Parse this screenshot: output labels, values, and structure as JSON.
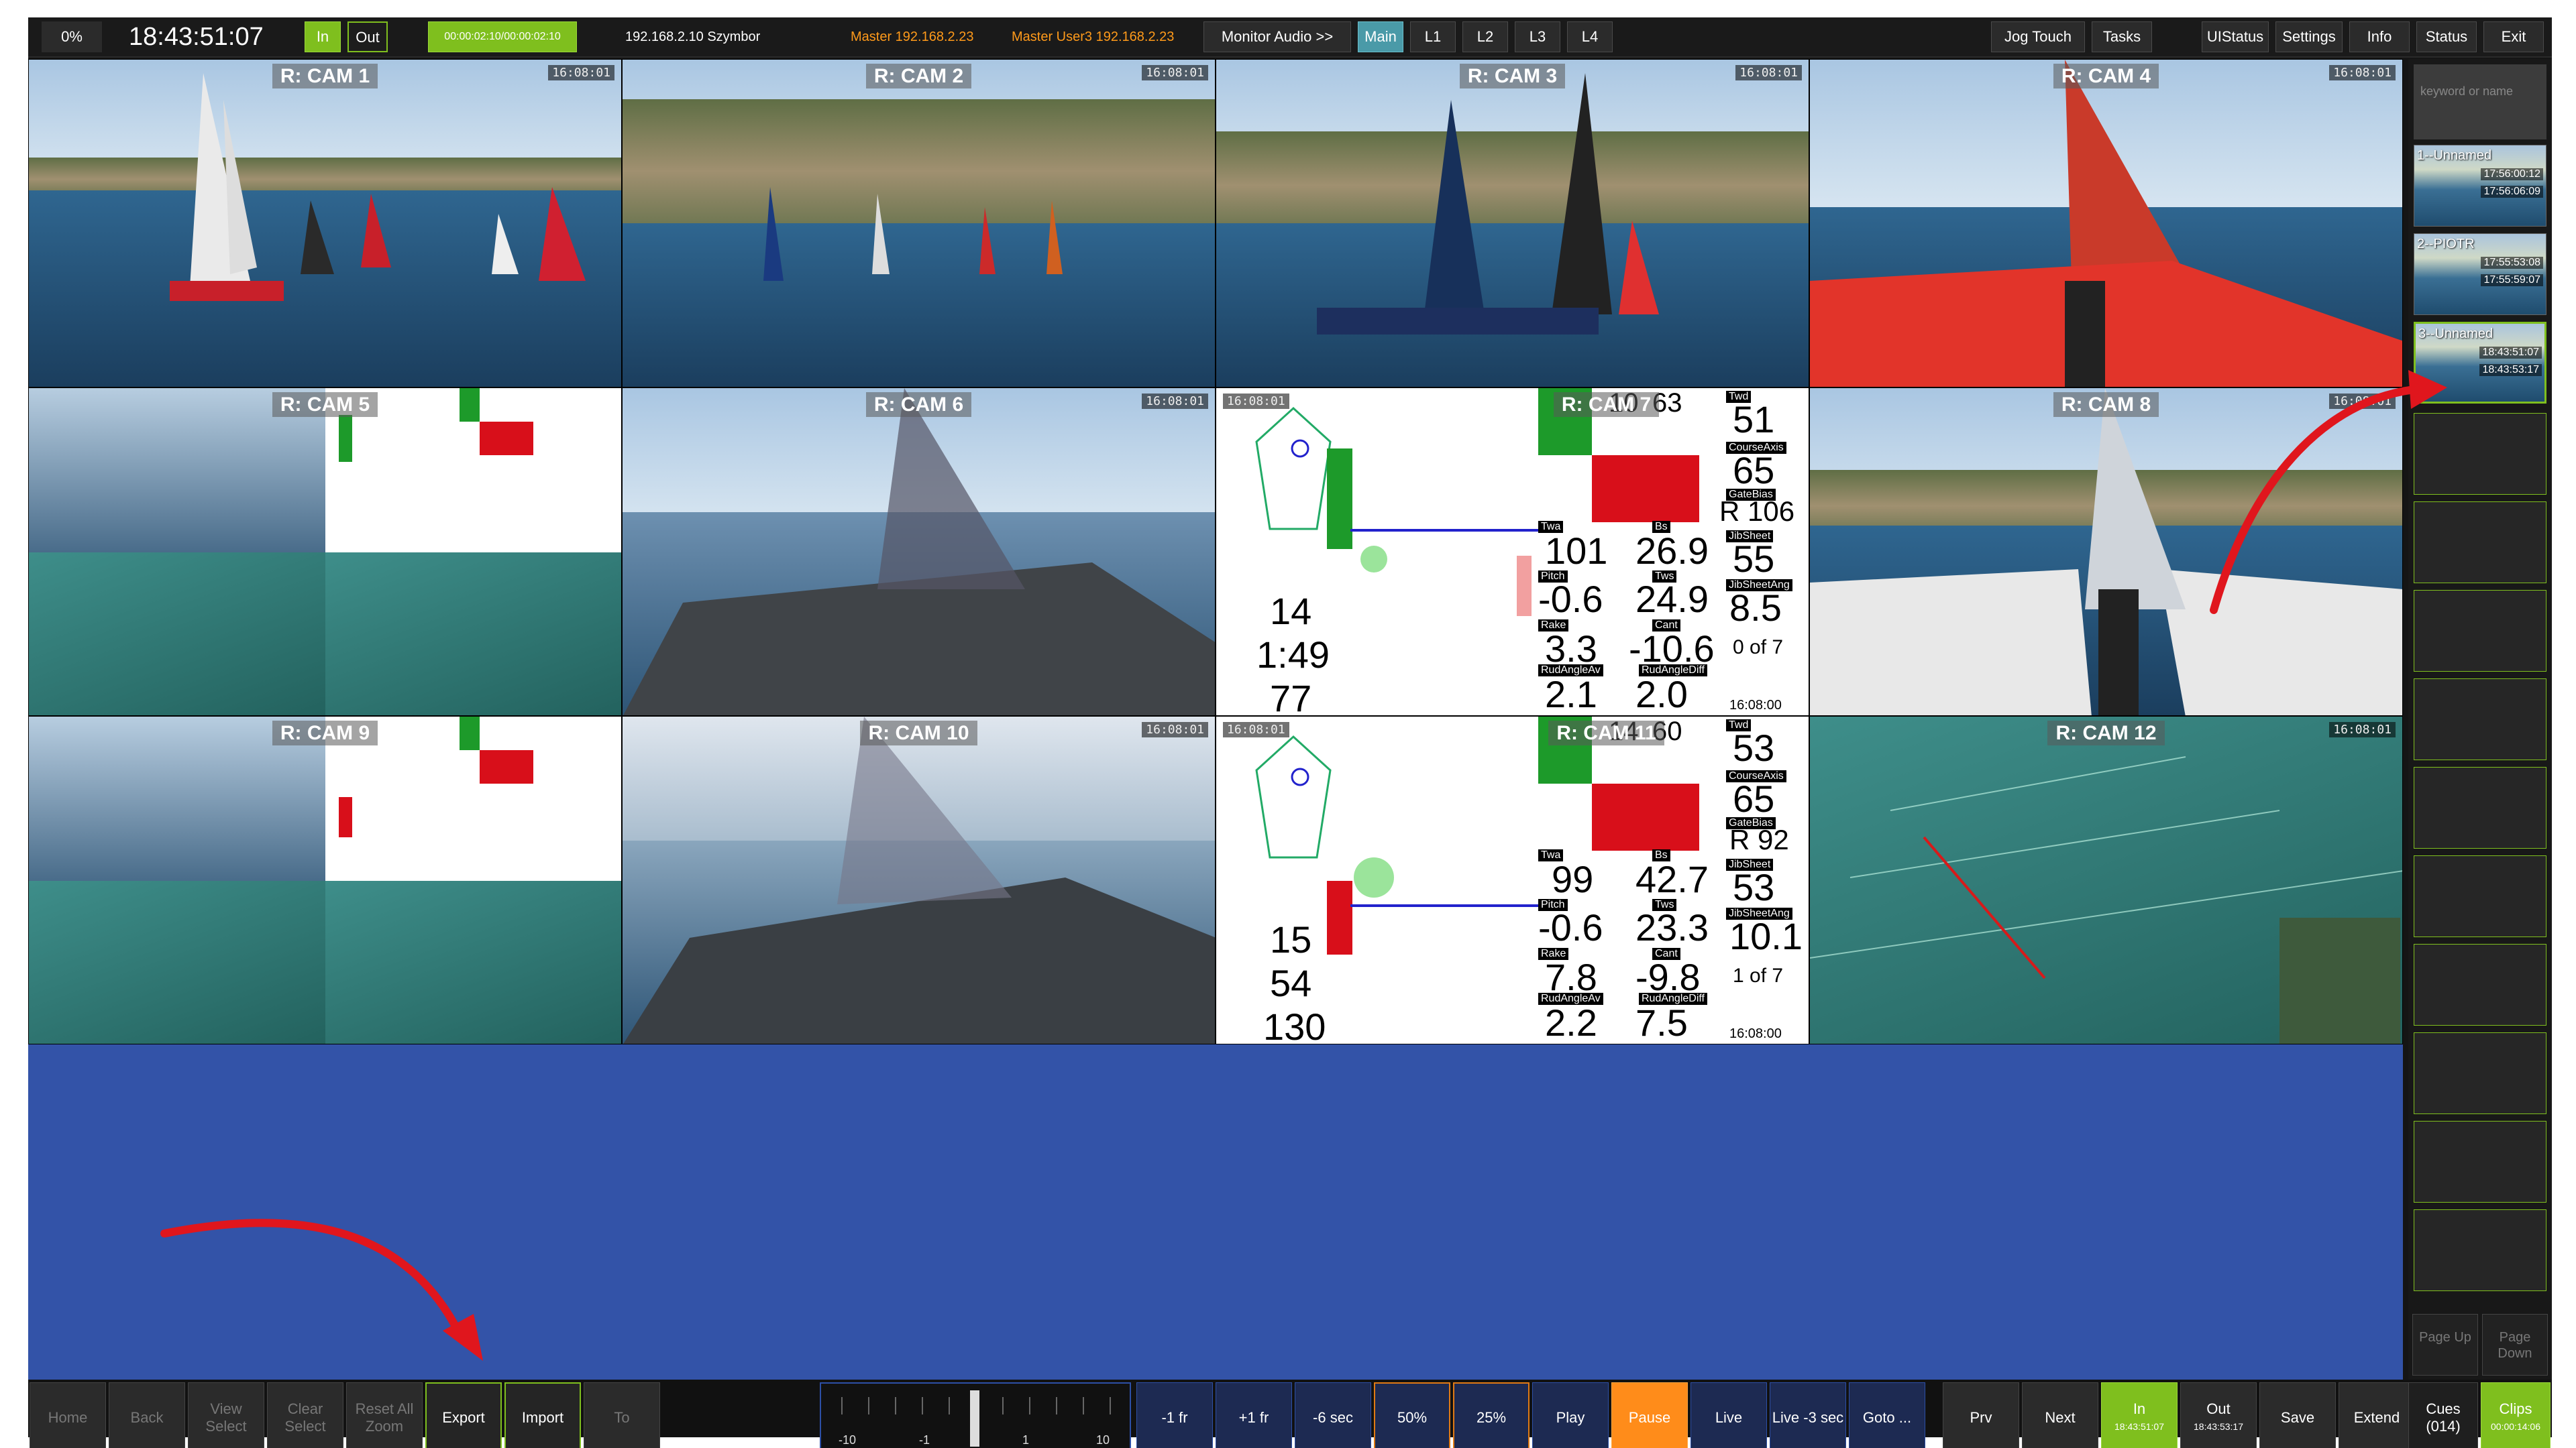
{
  "topbar": {
    "percent": "0%",
    "clock": "18:43:51:07",
    "in_label": "In",
    "out_label": "Out",
    "duration": "00:00:02:10/00:00:02:10",
    "host": "192.168.2.10 Szymbor",
    "master1": "Master 192.168.2.23",
    "master2": "Master  User3  192.168.2.23",
    "monitor_audio": "Monitor Audio >>",
    "views": [
      "Main",
      "L1",
      "L2",
      "L3",
      "L4"
    ],
    "right_buttons": [
      "Jog Touch",
      "Tasks",
      "UIStatus",
      "Settings",
      "Info",
      "Status",
      "Exit"
    ]
  },
  "cams": [
    {
      "label": "R: CAM 1",
      "tc": "16:08:01"
    },
    {
      "label": "R: CAM 2",
      "tc": "16:08:01"
    },
    {
      "label": "R: CAM 3",
      "tc": "16:08:01"
    },
    {
      "label": "R: CAM 4",
      "tc": "16:08:01"
    },
    {
      "label": "R: CAM 5",
      "tc": ""
    },
    {
      "label": "R: CAM 6",
      "tc": "16:08:01"
    },
    {
      "label": "R: CAM 7",
      "tc": "16:08:01"
    },
    {
      "label": "R: CAM 8",
      "tc": "16:08:01"
    },
    {
      "label": "R: CAM 9",
      "tc": ""
    },
    {
      "label": "R: CAM 10",
      "tc": "16:08:01"
    },
    {
      "label": "R: CAM 11",
      "tc": "16:08:01"
    },
    {
      "label": "R: CAM 12",
      "tc": "16:08:01"
    }
  ],
  "tele7": {
    "twd_label": "Twd",
    "twd": "51",
    "course_label": "CourseAxis",
    "course": "65",
    "gate_label": "GateBias",
    "gate": "R 106",
    "jib_label": "JibSheet",
    "jib": "55",
    "jibang_label": "JibSheetAng",
    "jibang": "8.5",
    "twa_label": "Twa",
    "twa": "101",
    "bs_label": "Bs",
    "bs": "26.9",
    "pitch_label": "Pitch",
    "pitch": "-0.6",
    "tws_label": "Tws",
    "tws": "24.9",
    "rake_label": "Rake",
    "rake": "3.3",
    "cant_label": "Cant",
    "cant": "-10.6",
    "rud_label": "RudAngleAv",
    "rud": "2.1",
    "ruddiff_label": "RudAngleDiff",
    "ruddiff": "2.0",
    "rank": "0 of 7",
    "time": "16:08:00",
    "top1": "10",
    "top2": "63",
    "left1": "14",
    "left2": "1:49",
    "left3": "77"
  },
  "tele11": {
    "twd": "53",
    "course": "65",
    "gate": "R 92",
    "jib": "53",
    "jibang": "10.1",
    "twa": "99",
    "bs": "42.7",
    "pitch": "-0.6",
    "tws": "23.3",
    "rake": "7.8",
    "cant": "-9.8",
    "rud": "2.2",
    "ruddiff": "7.5",
    "rank": "1 of 7",
    "time": "16:08:00",
    "top1": "14",
    "top2": "60",
    "left1": "15",
    "left2": "54",
    "left3": "130"
  },
  "clips": {
    "search_placeholder": "keyword or name",
    "items": [
      {
        "name": "1--Unnamed",
        "t1": "17:56:00:12",
        "t2": "17:56:06:09"
      },
      {
        "name": "2--PIOTR",
        "t1": "17:55:53:08",
        "t2": "17:55:59:07"
      },
      {
        "name": "3--Unnamed",
        "t1": "18:43:51:07",
        "t2": "18:43:53:17"
      }
    ],
    "page_up": "Page Up",
    "page_down": "Page Down"
  },
  "bottombar": {
    "home": "Home",
    "back": "Back",
    "view_select": "View Select",
    "clear_select": "Clear Select",
    "reset_zoom": "Reset All Zoom",
    "export": "Export",
    "import": "Import",
    "to": "To",
    "jog_labels": [
      "-10",
      "-1",
      "1",
      "10"
    ],
    "minus1fr": "-1 fr",
    "plus1fr": "+1 fr",
    "minus6sec": "-6 sec",
    "p50": "50%",
    "p25": "25%",
    "play": "Play",
    "pause": "Pause",
    "live": "Live",
    "live3": "Live -3 sec",
    "goto": "Goto ...",
    "prv": "Prv",
    "next": "Next",
    "in_label": "In",
    "in_time": "18:43:51:07",
    "out_label": "Out",
    "out_time": "18:43:53:17",
    "save": "Save",
    "extend": "Extend",
    "cues": "Cues",
    "cues_count": "(014)",
    "clips": "Clips",
    "clips_time": "00:00:14:06"
  },
  "colors": {
    "accent_green": "#7fbf1e",
    "pause_orange": "#ff8c1a",
    "highlight_blue": "#3353a8",
    "arrow_red": "#e0161d"
  }
}
